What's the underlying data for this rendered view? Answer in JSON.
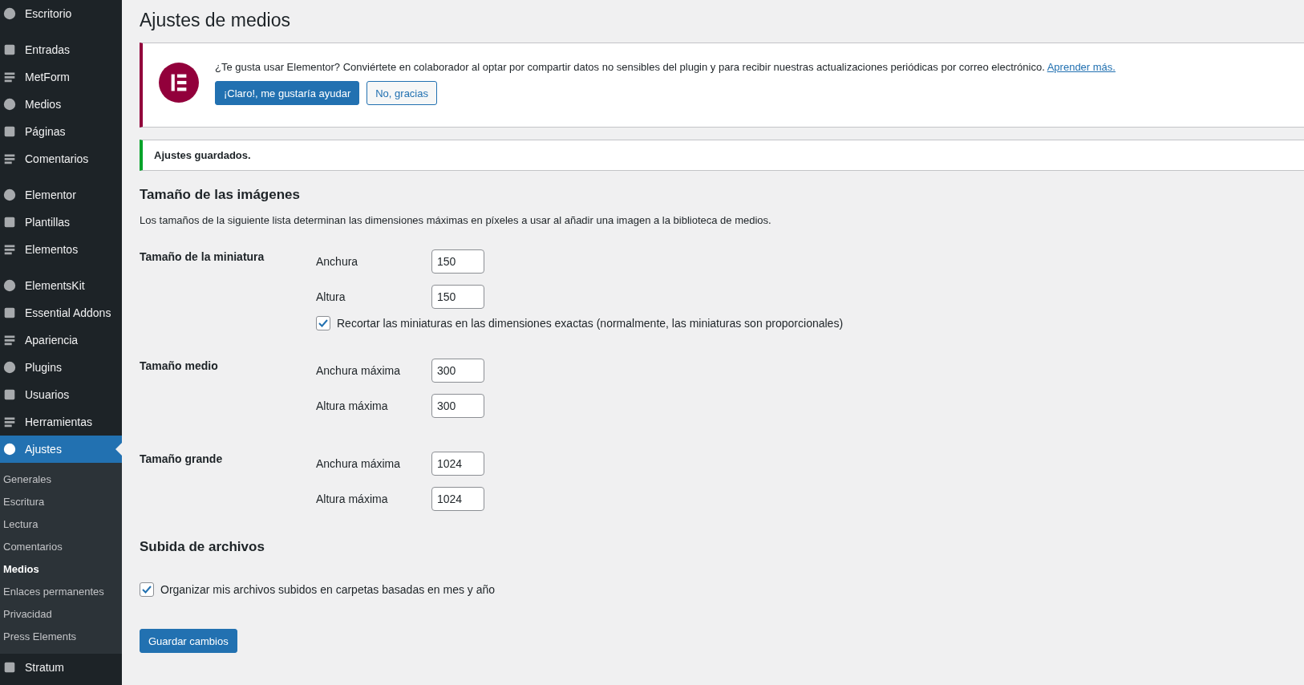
{
  "sidebar": {
    "groups": [
      {
        "items": [
          {
            "label": "Escritorio",
            "selected": false
          }
        ]
      },
      {
        "items": [
          {
            "label": "Entradas",
            "selected": false
          },
          {
            "label": "MetForm",
            "selected": false
          },
          {
            "label": "Medios",
            "selected": false
          },
          {
            "label": "Páginas",
            "selected": false
          },
          {
            "label": "Comentarios",
            "selected": false
          }
        ]
      },
      {
        "items": [
          {
            "label": "Elementor",
            "selected": false
          },
          {
            "label": "Plantillas",
            "selected": false
          },
          {
            "label": "Elementos",
            "selected": false
          }
        ]
      },
      {
        "items": [
          {
            "label": "ElementsKit",
            "selected": false
          },
          {
            "label": "Essential Addons",
            "selected": false
          },
          {
            "label": "Apariencia",
            "selected": false
          },
          {
            "label": "Plugins",
            "selected": false
          },
          {
            "label": "Usuarios",
            "selected": false
          },
          {
            "label": "Herramientas",
            "selected": false
          },
          {
            "label": "Ajustes",
            "selected": true,
            "children": [
              {
                "label": "Generales",
                "selected": false
              },
              {
                "label": "Escritura",
                "selected": false
              },
              {
                "label": "Lectura",
                "selected": false
              },
              {
                "label": "Comentarios",
                "selected": false
              },
              {
                "label": "Medios",
                "selected": true
              },
              {
                "label": "Enlaces permanentes",
                "selected": false
              },
              {
                "label": "Privacidad",
                "selected": false
              },
              {
                "label": "Press Elements",
                "selected": false
              }
            ]
          },
          {
            "label": "Stratum",
            "selected": false
          }
        ]
      }
    ]
  },
  "page_title": "Ajustes de medios",
  "elementor_notice": {
    "text": "¿Te gusta usar Elementor? Conviértete en colaborador al optar por compartir datos no sensibles del plugin y para recibir nuestras actualizaciones periódicas por correo electrónico.",
    "link": "Aprender más.",
    "accept_button": "¡Claro!, me gustaría ayudar",
    "decline_button": "No, gracias"
  },
  "success_notice": "Ajustes guardados.",
  "image_sizes": {
    "heading": "Tamaño de las imágenes",
    "description": "Los tamaños de la siguiente lista determinan las dimensiones máximas en píxeles a usar al añadir una imagen a la biblioteca de medios.",
    "groups": [
      {
        "label": "Tamaño de la miniatura",
        "fields": [
          {
            "label": "Anchura",
            "value": "150"
          },
          {
            "label": "Altura",
            "value": "150"
          }
        ],
        "checkbox": {
          "label": "Recortar las miniaturas en las dimensiones exactas (normalmente, las miniaturas son proporcionales)",
          "checked": true
        }
      },
      {
        "label": "Tamaño medio",
        "fields": [
          {
            "label": "Anchura máxima",
            "value": "300"
          },
          {
            "label": "Altura máxima",
            "value": "300"
          }
        ]
      },
      {
        "label": "Tamaño grande",
        "fields": [
          {
            "label": "Anchura máxima",
            "value": "1024"
          },
          {
            "label": "Altura máxima",
            "value": "1024"
          }
        ]
      }
    ]
  },
  "uploads": {
    "heading": "Subida de archivos",
    "checkbox": {
      "label": "Organizar mis archivos subidos en carpetas basadas en mes y año",
      "checked": true
    }
  },
  "save_button": "Guardar cambios"
}
